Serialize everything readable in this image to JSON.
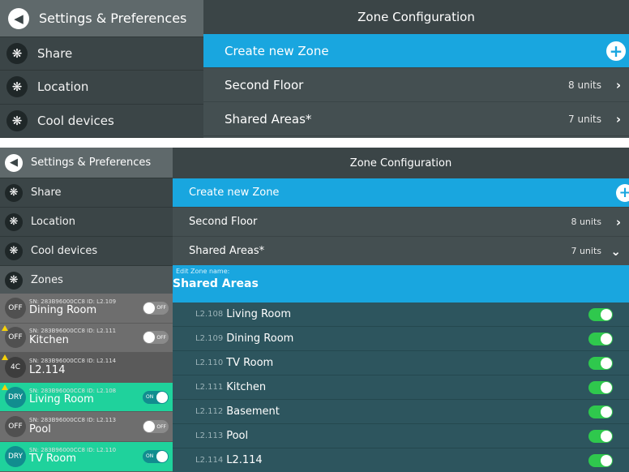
{
  "top": {
    "sidebar": {
      "header": "Settings & Preferences",
      "items": [
        {
          "label": "Share",
          "icon": "fan-icon"
        },
        {
          "label": "Location",
          "icon": "fan-icon"
        },
        {
          "label": "Cool devices",
          "icon": "fan-icon"
        }
      ]
    },
    "main": {
      "title": "Zone Configuration",
      "create_label": "Create new Zone",
      "zones": [
        {
          "name": "Second Floor",
          "units": "8 units"
        },
        {
          "name": "Shared Areas*",
          "units": "7 units"
        }
      ]
    }
  },
  "bottom": {
    "sidebar": {
      "header": "Settings & Preferences",
      "items": [
        {
          "label": "Share",
          "icon": "fan-icon"
        },
        {
          "label": "Location",
          "icon": "fan-icon"
        },
        {
          "label": "Cool devices",
          "icon": "fan-icon"
        },
        {
          "label": "Zones",
          "icon": "fan-icon"
        }
      ]
    },
    "devices": [
      {
        "mode": "OFF",
        "sn": "SN: 283B96000CC8 ID: L2.109",
        "name": "Dining Room",
        "switch": "OFF",
        "warn": false
      },
      {
        "mode": "OFF",
        "sn": "SN: 283B96000CC8 ID: L2.111",
        "name": "Kitchen",
        "switch": "OFF",
        "warn": true
      },
      {
        "mode": "4C",
        "sn": "SN: 283B96000CC8 ID: L2.114",
        "name": "L2.114",
        "switch": "",
        "warn": true
      },
      {
        "mode": "DRY",
        "sn": "SN: 283B96000CC8 ID: L2.108",
        "name": "Living Room",
        "switch": "ON",
        "warn": true
      },
      {
        "mode": "OFF",
        "sn": "SN: 283B96000CC8 ID: L2.113",
        "name": "Pool",
        "switch": "OFF",
        "warn": false
      },
      {
        "mode": "DRY",
        "sn": "SN: 283B96000CC8 ID: L2.110",
        "name": "TV Room",
        "switch": "ON",
        "warn": false
      }
    ],
    "main": {
      "title": "Zone Configuration",
      "create_label": "Create new Zone",
      "zones": [
        {
          "name": "Second Floor",
          "units": "8 units"
        },
        {
          "name": "Shared Areas*",
          "units": "7 units"
        }
      ],
      "edit_label": "Edit Zone name:",
      "edit_value": "Shared Areas",
      "zone_units": [
        {
          "code": "L2.108",
          "name": "Living Room"
        },
        {
          "code": "L2.109",
          "name": "Dining Room"
        },
        {
          "code": "L2.110",
          "name": "TV Room"
        },
        {
          "code": "L2.111",
          "name": "Kitchen"
        },
        {
          "code": "L2.112",
          "name": "Basement"
        },
        {
          "code": "L2.113",
          "name": "Pool"
        },
        {
          "code": "L2.114",
          "name": "L2.114"
        }
      ]
    }
  },
  "colors": {
    "accent": "#19a6df",
    "toggle_on": "#2fc84d",
    "device_on": "#1fd29c"
  }
}
